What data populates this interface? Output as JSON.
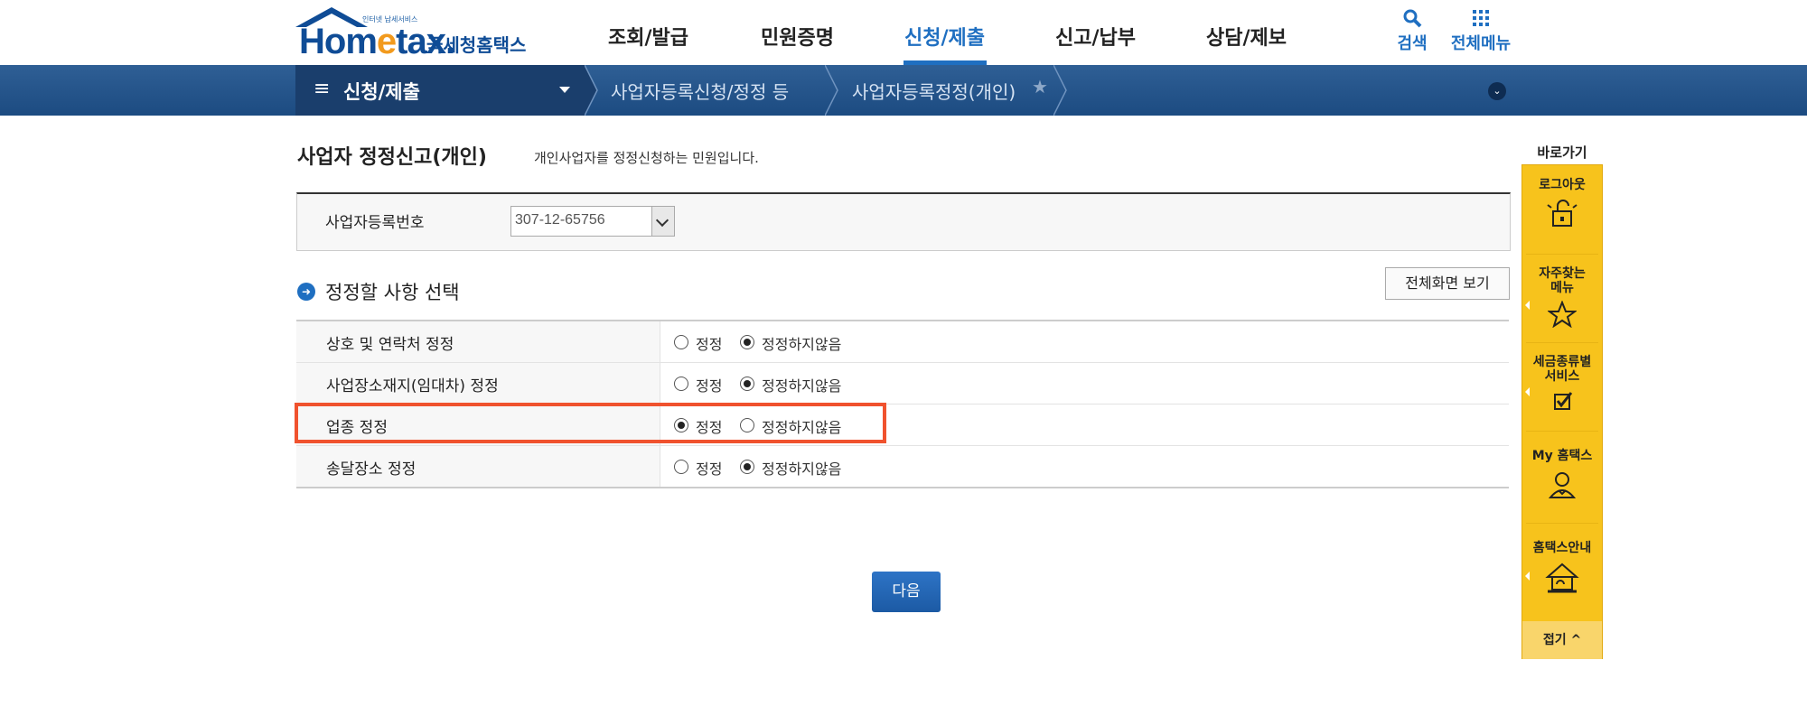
{
  "header": {
    "logo_tagline": "인터넷 납세서비스",
    "logo_word_a": "Hom",
    "logo_word_e": "e",
    "logo_word_b": "tax.",
    "logo_sub": "국세청홈택스",
    "gnb": [
      "조회/발급",
      "민원증명",
      "신청/제출",
      "신고/납부",
      "상담/제보"
    ],
    "active_gnb": "신청/제출",
    "search_label": "검색",
    "all_menu_label": "전체메뉴"
  },
  "nav": {
    "menu_label": "신청/제출",
    "crumb1": "사업자등록신청/정정 등",
    "crumb2": "사업자등록정정(개인)"
  },
  "page": {
    "title": "사업자 정정신고(개인)",
    "description": "개인사업자를 정정신청하는 민원입니다."
  },
  "biz": {
    "label": "사업자등록번호",
    "value": "307-12-65756"
  },
  "section": {
    "title": "정정할 사항 선택",
    "full_screen_button": "전체화면 보기"
  },
  "options": {
    "correct": "정정",
    "no_correct": "정정하지않음"
  },
  "rows": [
    {
      "label": "상호 및 연락처 정정",
      "selected": "정정하지않음"
    },
    {
      "label": "사업장소재지(임대차) 정정",
      "selected": "정정하지않음"
    },
    {
      "label": "업종 정정",
      "selected": "정정"
    },
    {
      "label": "송달장소 정정",
      "selected": "정정하지않음"
    }
  ],
  "next_button": "다음",
  "quick": {
    "title": "바로가기",
    "logout": "로그아웃",
    "faq_line1": "자주찾는",
    "faq_line2": "메뉴",
    "tax_line1": "세금종류별",
    "tax_line2": "서비스",
    "my": "My 홈택스",
    "guide": "홈택스안내",
    "fold": "접기 ^"
  },
  "colors": {
    "brand_blue": "#1f6fc1",
    "nav_band": "#2f5f95",
    "highlight": "#f0522e",
    "quick_panel": "#f7c31c"
  }
}
